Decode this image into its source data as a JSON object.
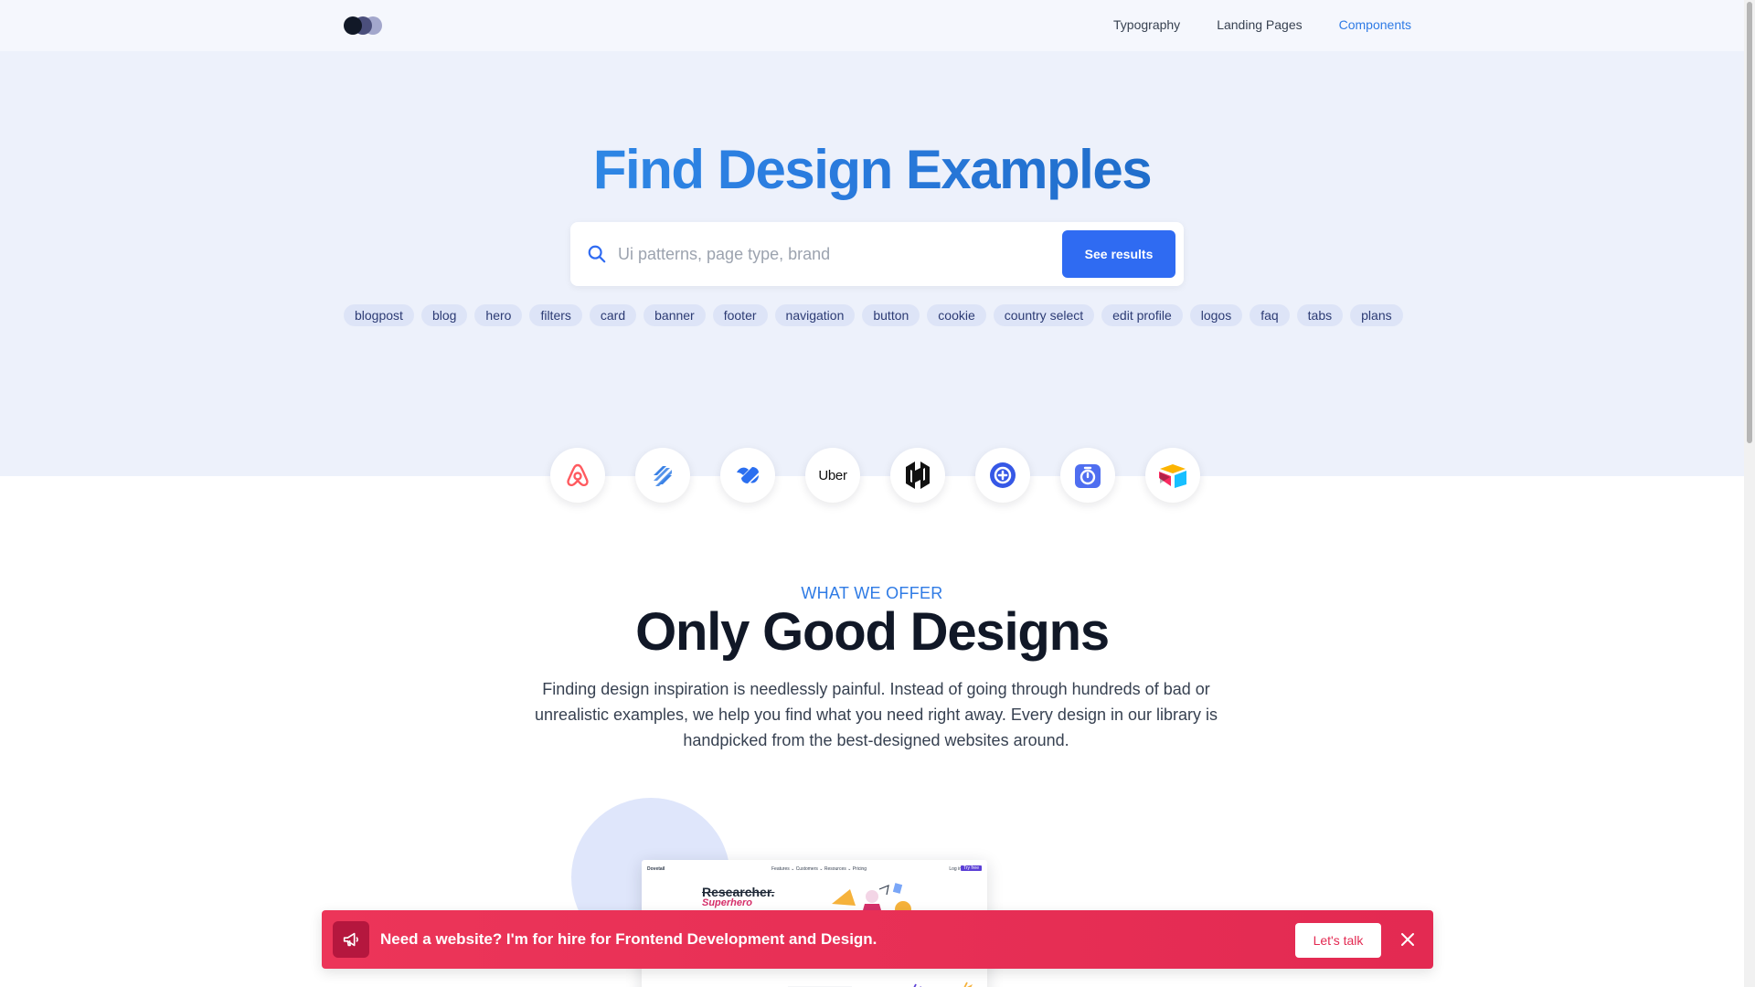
{
  "header": {
    "logo_name": "three-dots-logo",
    "nav": [
      {
        "label": "Typography",
        "active": false
      },
      {
        "label": "Landing Pages",
        "active": false
      },
      {
        "label": "Components",
        "active": true
      }
    ]
  },
  "hero": {
    "title": "Find Design Examples",
    "search": {
      "placeholder": "Ui patterns, page type, brand",
      "value": "",
      "button_label": "See results",
      "icon": "search-icon"
    },
    "tags": [
      "blogpost",
      "blog",
      "hero",
      "filters",
      "card",
      "banner",
      "footer",
      "navigation",
      "button",
      "cookie",
      "country select",
      "edit profile",
      "logos",
      "faq",
      "tabs",
      "plans"
    ]
  },
  "brands": [
    {
      "name": "airbnb-logo"
    },
    {
      "name": "helpscout-logo"
    },
    {
      "name": "basecamp-logo"
    },
    {
      "name": "uber-logo",
      "text": "Uber"
    },
    {
      "name": "hashicorp-logo"
    },
    {
      "name": "chat-bubble-logo"
    },
    {
      "name": "timer-logo"
    },
    {
      "name": "airtable-logo"
    }
  ],
  "offer": {
    "eyebrow": "WHAT WE OFFER",
    "title": "Only Good Designs",
    "description": "Finding design inspiration is needlessly painful. Instead of going through hundreds of bad or unrealistic examples, we help you find what you need right away. Every design in our library is handpicked from the best-designed websites around."
  },
  "preview": {
    "brand": "Dovetail",
    "links": "Features ⌄   Customers ⌄   Resources ⌄   Pricing",
    "login": "Log in",
    "cta": "Try free",
    "headline_struck": "Researcher.",
    "headline_accent": "Superhero"
  },
  "banner": {
    "icon": "megaphone-icon",
    "text": "Need a website? I'm for hire for Frontend Development and Design.",
    "button_label": "Let's talk",
    "close_icon": "close-icon",
    "colors": {
      "background": "#e32a52",
      "icon_bg": "#b5173e"
    }
  },
  "colors": {
    "accent": "#2f7be5",
    "primary_button": "#2f6bf2",
    "hero_bg": "#edf1fb",
    "tag_bg": "#dde4f7"
  }
}
